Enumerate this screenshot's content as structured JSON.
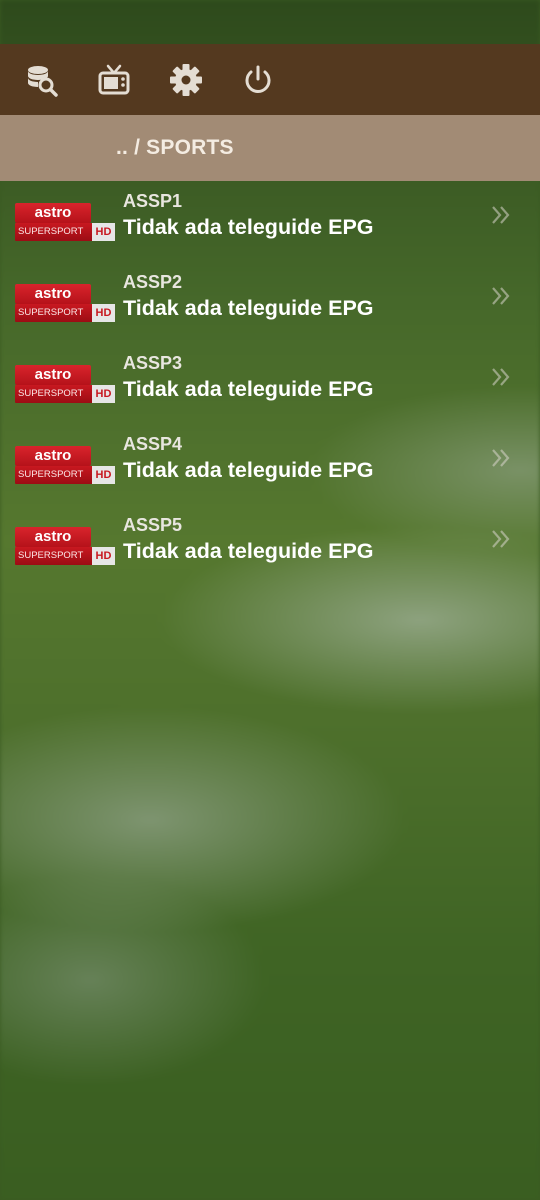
{
  "toolbar": {
    "icons": [
      "search-database-icon",
      "tv-icon",
      "gear-icon",
      "power-icon"
    ]
  },
  "breadcrumb": {
    "path": ".. / SPORTS"
  },
  "channels": [
    {
      "name": "ASSP1",
      "epg": "Tidak ada teleguide EPG",
      "logo": {
        "brand": "astro",
        "sub": "SUPERSPORT",
        "badge": "HD"
      }
    },
    {
      "name": "ASSP2",
      "epg": "Tidak ada teleguide EPG",
      "logo": {
        "brand": "astro",
        "sub": "SUPERSPORT",
        "badge": "HD"
      }
    },
    {
      "name": "ASSP3",
      "epg": "Tidak ada teleguide EPG",
      "logo": {
        "brand": "astro",
        "sub": "SUPERSPORT",
        "badge": "HD"
      }
    },
    {
      "name": "ASSP4",
      "epg": "Tidak ada teleguide EPG",
      "logo": {
        "brand": "astro",
        "sub": "SUPERSPORT",
        "badge": "HD"
      }
    },
    {
      "name": "ASSP5",
      "epg": "Tidak ada teleguide EPG",
      "logo": {
        "brand": "astro",
        "sub": "SUPERSPORT",
        "badge": "HD"
      }
    }
  ],
  "colors": {
    "toolbar_bg": "#54391f",
    "breadcrumb_bg": "#a28b75",
    "logo_red": "#c81820"
  }
}
